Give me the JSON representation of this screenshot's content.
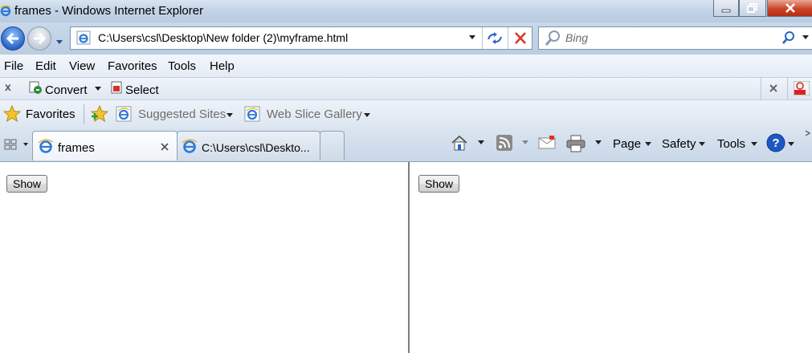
{
  "window": {
    "title": "frames - Windows Internet Explorer"
  },
  "address_bar": {
    "url": "C:\\Users\\csl\\Desktop\\New folder (2)\\myframe.html"
  },
  "search": {
    "placeholder": "Bing"
  },
  "menu": {
    "items": [
      "File",
      "Edit",
      "View",
      "Favorites",
      "Tools",
      "Help"
    ]
  },
  "convert_toolbar": {
    "close": "x",
    "convert_label": "Convert",
    "select_label": "Select"
  },
  "favorites_bar": {
    "favorites_label": "Favorites",
    "suggested_sites": "Suggested Sites",
    "web_slice_gallery": "Web Slice Gallery"
  },
  "tabs": [
    {
      "label": "frames",
      "active": true
    },
    {
      "label": "C:\\Users\\csl\\Deskto..."
    }
  ],
  "command_bar": {
    "page": "Page",
    "safety": "Safety",
    "tools": "Tools"
  },
  "frames": {
    "left_button": "Show",
    "right_button": "Show"
  },
  "colors": {
    "title_bar": "#c3d4e7",
    "accent_blue": "#2a64c6",
    "close_red": "#c8452a"
  }
}
